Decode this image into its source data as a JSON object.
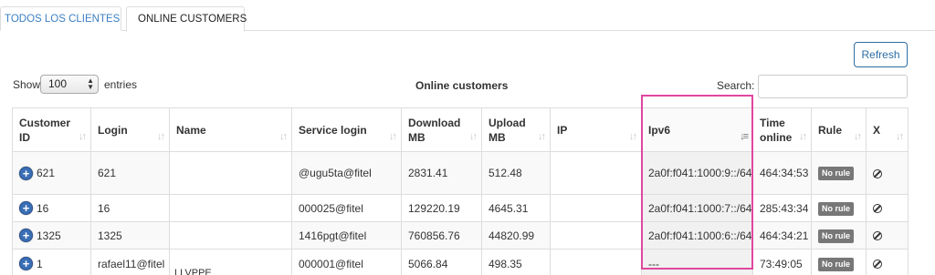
{
  "tabs": [
    {
      "label": "TODOS LOS CLIENTES",
      "active": false
    },
    {
      "label": "ONLINE CUSTOMERS",
      "active": true
    }
  ],
  "toolbar": {
    "refresh_label": "Refresh"
  },
  "length_menu": {
    "show_label": "Show",
    "selected": "100",
    "entries_label": "entries"
  },
  "table_title": "Online customers",
  "search": {
    "label": "Search:",
    "value": "",
    "placeholder": ""
  },
  "columns": [
    {
      "label": "Customer ID",
      "sort": "both"
    },
    {
      "label": "Login",
      "sort": "both"
    },
    {
      "label": "Name",
      "sort": "both"
    },
    {
      "label": "Service login",
      "sort": "both"
    },
    {
      "label": "Download MB",
      "sort": "both"
    },
    {
      "label": "Upload MB",
      "sort": "both"
    },
    {
      "label": "IP",
      "sort": "both"
    },
    {
      "label": "Ipv6",
      "sort": "desc"
    },
    {
      "label": "Time online",
      "sort": "both"
    },
    {
      "label": "Rule",
      "sort": "both"
    },
    {
      "label": "X",
      "sort": "both"
    }
  ],
  "rows": [
    {
      "customer_id": "621",
      "login": "621",
      "name": "",
      "service_login": "@ugu5ta@fitel",
      "download_mb": "2831.41",
      "upload_mb": "512.48",
      "ip": "",
      "ipv6": "2a0f:f041:1000:9::/64",
      "time_online": "464:34:53",
      "rule": "No rule"
    },
    {
      "customer_id": "16",
      "login": "16",
      "name": "",
      "service_login": "000025@fitel",
      "download_mb": "129220.19",
      "upload_mb": "4645.31",
      "ip": "",
      "ipv6": "2a0f:f041:1000:7::/64",
      "time_online": "285:43:34",
      "rule": "No rule"
    },
    {
      "customer_id": "1325",
      "login": "1325",
      "name": "",
      "service_login": "1416pgt@fitel",
      "download_mb": "760856.76",
      "upload_mb": "44820.99",
      "ip": "",
      "ipv6": "2a0f:f041:1000:6::/64",
      "time_online": "464:34:21",
      "rule": "No rule"
    },
    {
      "customer_id": "1",
      "login": "rafael11@fitel",
      "name": "",
      "service_login": "000001@fitel",
      "download_mb": "5066.84",
      "upload_mb": "498.35",
      "ip": "",
      "ipv6": "---",
      "time_online": "73:49:05",
      "rule": "No rule"
    }
  ],
  "partial_name_text": "LLVPPE",
  "icons": {
    "expand": "plus-circle-icon",
    "delete": "ban-icon",
    "sort": "sort-arrows-icon",
    "sort_active": "sort-desc-icon",
    "select_arrow": "select-arrows-icon"
  },
  "colors": {
    "accent": "#2e6da4",
    "link": "#3b7fc4",
    "highlight": "#e0479e",
    "badge": "#777777",
    "expand": "#3a6eb5"
  }
}
